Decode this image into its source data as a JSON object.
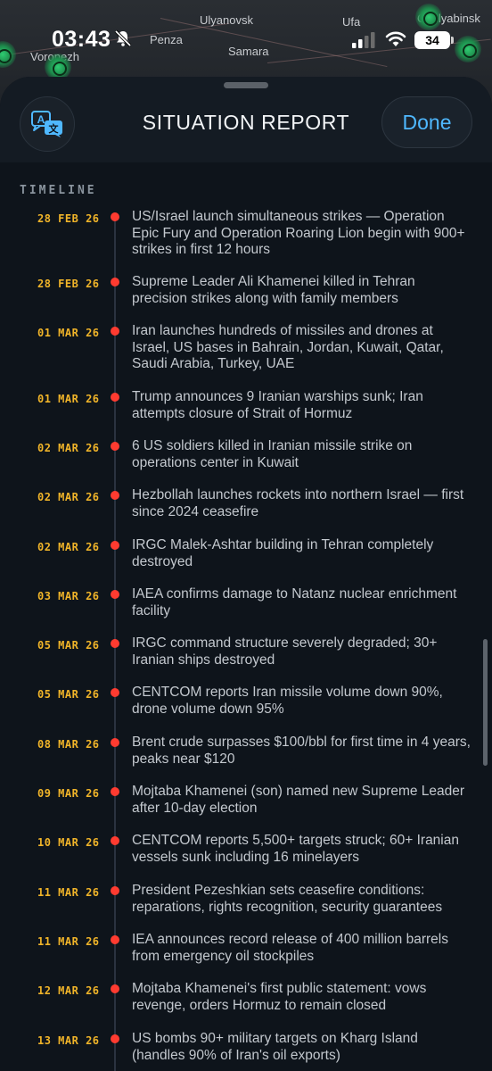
{
  "status": {
    "time": "03:43",
    "battery": "34"
  },
  "map": {
    "cities": [
      "Ulyanovsk",
      "Ufa",
      "Chelyabinsk",
      "Penza",
      "Voronezh",
      "Samara"
    ]
  },
  "sheet": {
    "title": "SITUATION REPORT",
    "done_label": "Done",
    "translate_icon": "translate-icon"
  },
  "timeline": {
    "label": "TIMELINE",
    "events": [
      {
        "date": "28 FEB 26",
        "text": "US/Israel launch simultaneous strikes — Operation Epic Fury and Operation Roaring Lion begin with 900+ strikes in first 12 hours"
      },
      {
        "date": "28 FEB 26",
        "text": "Supreme Leader Ali Khamenei killed in Tehran precision strikes along with family members"
      },
      {
        "date": "01 MAR 26",
        "text": "Iran launches hundreds of missiles and drones at Israel, US bases in Bahrain, Jordan, Kuwait, Qatar, Saudi Arabia, Turkey, UAE"
      },
      {
        "date": "01 MAR 26",
        "text": "Trump announces 9 Iranian warships sunk; Iran attempts closure of Strait of Hormuz"
      },
      {
        "date": "02 MAR 26",
        "text": "6 US soldiers killed in Iranian missile strike on operations center in Kuwait"
      },
      {
        "date": "02 MAR 26",
        "text": "Hezbollah launches rockets into northern Israel — first since 2024 ceasefire"
      },
      {
        "date": "02 MAR 26",
        "text": "IRGC Malek-Ashtar building in Tehran completely destroyed"
      },
      {
        "date": "03 MAR 26",
        "text": "IAEA confirms damage to Natanz nuclear enrichment facility"
      },
      {
        "date": "05 MAR 26",
        "text": "IRGC command structure severely degraded; 30+ Iranian ships destroyed"
      },
      {
        "date": "05 MAR 26",
        "text": "CENTCOM reports Iran missile volume down 90%, drone volume down 95%"
      },
      {
        "date": "08 MAR 26",
        "text": "Brent crude surpasses $100/bbl for first time in 4 years, peaks near $120"
      },
      {
        "date": "09 MAR 26",
        "text": "Mojtaba Khamenei (son) named new Supreme Leader after 10-day election"
      },
      {
        "date": "10 MAR 26",
        "text": "CENTCOM reports 5,500+ targets struck; 60+ Iranian vessels sunk including 16 minelayers"
      },
      {
        "date": "11 MAR 26",
        "text": "President Pezeshkian sets ceasefire conditions: reparations, rights recognition, security guarantees"
      },
      {
        "date": "11 MAR 26",
        "text": "IEA announces record release of 400 million barrels from emergency oil stockpiles"
      },
      {
        "date": "12 MAR 26",
        "text": "Mojtaba Khamenei's first public statement: vows revenge, orders Hormuz to remain closed"
      },
      {
        "date": "13 MAR 26",
        "text": "US bombs 90+ military targets on Kharg Island (handles 90% of Iran's oil exports)"
      }
    ]
  },
  "colors": {
    "accent": "#4fb8ff",
    "date": "#f0b429",
    "dot": "#ff3b30"
  }
}
